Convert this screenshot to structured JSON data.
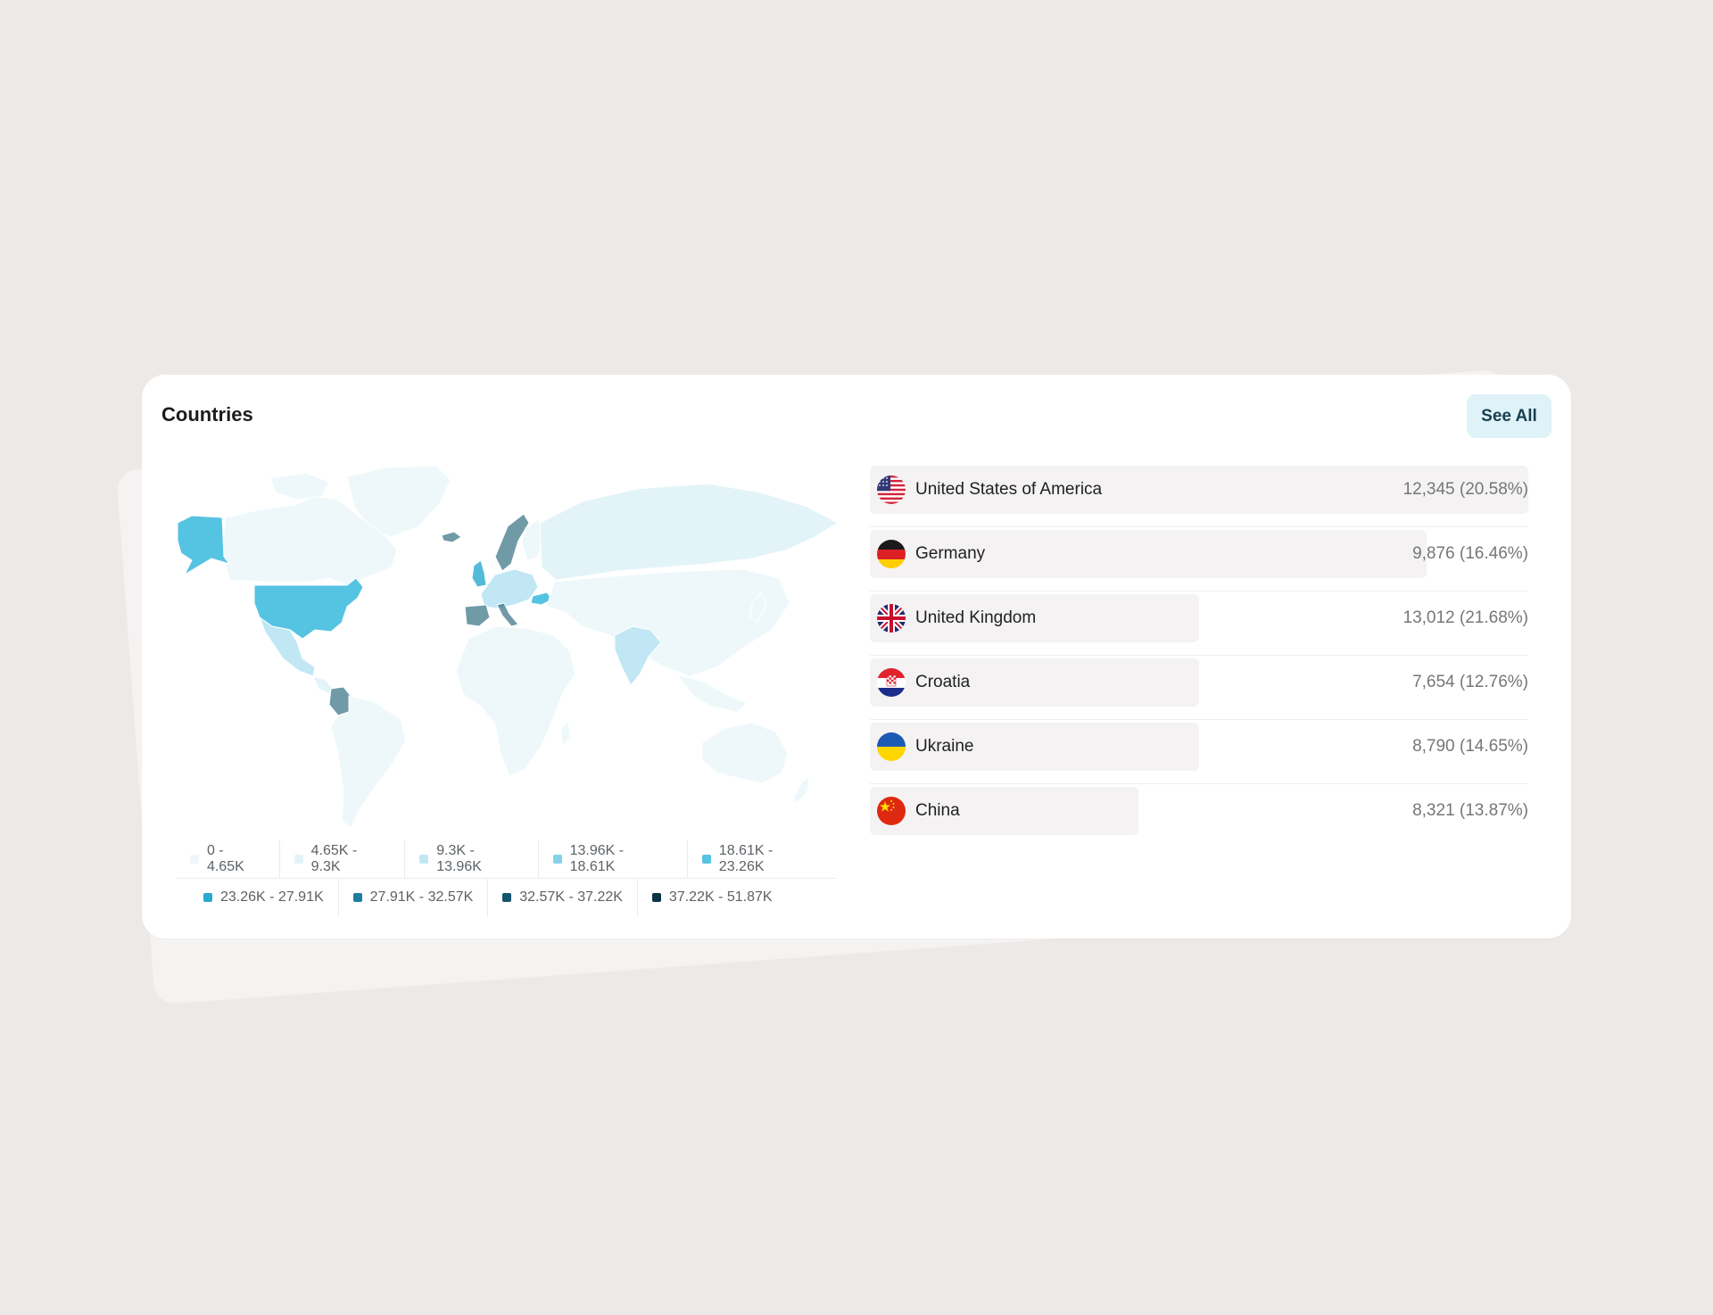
{
  "card": {
    "title": "Countries",
    "see_all_label": "See All"
  },
  "colors": {
    "background": "#ede9e7",
    "card": "#ffffff",
    "button_bg": "#dff2f8",
    "button_text": "#173f4f",
    "bar": "#f4f2f2"
  },
  "legend": {
    "items": [
      {
        "label": "0 - 4.65K",
        "color": "#eef8fb"
      },
      {
        "label": "4.65K - 9.3K",
        "color": "#e3f4f9"
      },
      {
        "label": "9.3K - 13.96K",
        "color": "#c1e7f4"
      },
      {
        "label": "13.96K - 18.61K",
        "color": "#87d2ea"
      },
      {
        "label": "18.61K - 23.26K",
        "color": "#55c3e2"
      },
      {
        "label": "23.26K - 27.91K",
        "color": "#2ba9d0"
      },
      {
        "label": "27.91K - 32.57K",
        "color": "#1d7f9e"
      },
      {
        "label": "32.57K - 37.22K",
        "color": "#13566c"
      },
      {
        "label": "37.22K - 51.87K",
        "color": "#0d3444"
      }
    ]
  },
  "countries": [
    {
      "name": "United States of America",
      "value": "12,345 (20.58%)",
      "bar_fraction": 1.0,
      "flag": "usa-flag-icon"
    },
    {
      "name": "Germany",
      "value": "9,876 (16.46%)",
      "bar_fraction": 0.846,
      "flag": "germany-flag-icon"
    },
    {
      "name": "United Kingdom",
      "value": "13,012 (21.68%)",
      "bar_fraction": 0.5,
      "flag": "uk-flag-icon"
    },
    {
      "name": "Croatia",
      "value": "7,654 (12.76%)",
      "bar_fraction": 0.5,
      "flag": "croatia-flag-icon"
    },
    {
      "name": "Ukraine",
      "value": "8,790 (14.65%)",
      "bar_fraction": 0.5,
      "flag": "ukraine-flag-icon"
    },
    {
      "name": "China",
      "value": "8,321 (13.87%)",
      "bar_fraction": 0.408,
      "flag": "china-flag-icon"
    }
  ]
}
